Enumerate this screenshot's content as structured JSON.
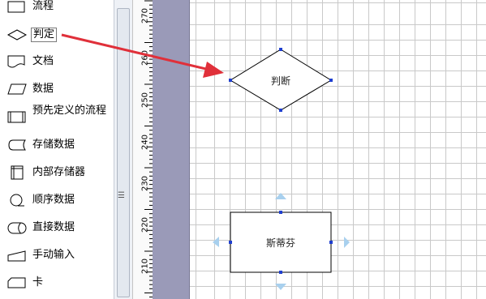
{
  "shape_panel": {
    "items": [
      {
        "label": "流程",
        "icon": "process-shape-icon"
      },
      {
        "label": "判定",
        "icon": "decision-shape-icon"
      },
      {
        "label": "文档",
        "icon": "document-shape-icon"
      },
      {
        "label": "数据",
        "icon": "data-shape-icon"
      },
      {
        "label": "预先定义的流程",
        "icon": "predefined-process-shape-icon"
      },
      {
        "label": "存储数据",
        "icon": "stored-data-shape-icon"
      },
      {
        "label": "内部存储器",
        "icon": "internal-storage-shape-icon"
      },
      {
        "label": "顺序数据",
        "icon": "sequential-data-shape-icon"
      },
      {
        "label": "直接数据",
        "icon": "direct-data-shape-icon"
      },
      {
        "label": "手动输入",
        "icon": "manual-input-shape-icon"
      },
      {
        "label": "卡",
        "icon": "card-shape-icon"
      }
    ]
  },
  "ruler": {
    "labels": [
      "270",
      "260",
      "250",
      "240",
      "230",
      "220",
      "210"
    ]
  },
  "canvas": {
    "decision_node": {
      "text": "判断"
    },
    "process_node": {
      "text": "斯蒂芬"
    }
  },
  "colors": {
    "arrow": "#e0303a",
    "handle": "#1f3fcf",
    "connection_hint": "#a8d0ee",
    "offpage": "#9a9ab8",
    "grid": "#c9c9c9"
  }
}
